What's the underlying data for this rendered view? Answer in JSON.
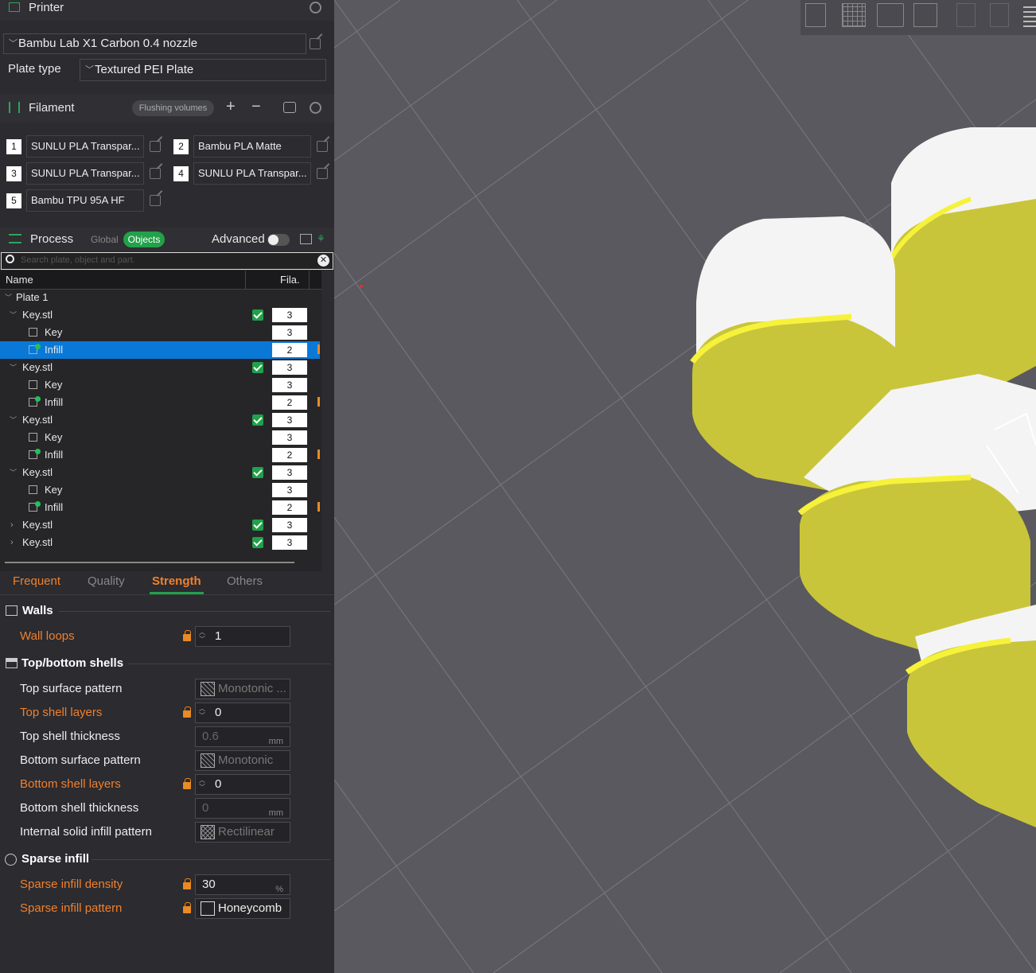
{
  "printer": {
    "title": "Printer",
    "machine": "Bambu Lab X1 Carbon 0.4 nozzle",
    "plate_type_label": "Plate type",
    "plate_type": "Textured PEI Plate"
  },
  "filament": {
    "title": "Filament",
    "flushing_label": "Flushing volumes",
    "slots": [
      {
        "num": "1",
        "name": "SUNLU PLA Transpar..."
      },
      {
        "num": "2",
        "name": "Bambu PLA Matte"
      },
      {
        "num": "3",
        "name": "SUNLU PLA Transpar..."
      },
      {
        "num": "4",
        "name": "SUNLU PLA Transpar..."
      },
      {
        "num": "5",
        "name": "Bambu TPU 95A HF"
      }
    ]
  },
  "process": {
    "title": "Process",
    "global_label": "Global",
    "objects_label": "Objects",
    "advanced_label": "Advanced",
    "search_placeholder": "Search plate, object and part."
  },
  "tree": {
    "col_name": "Name",
    "col_fila": "Fila.",
    "rows": [
      {
        "label": "Plate 1",
        "fila": ""
      },
      {
        "label": "Key.stl",
        "fila": "3"
      },
      {
        "label": "Key",
        "fila": "3"
      },
      {
        "label": "Infill",
        "fila": "2"
      },
      {
        "label": "Key.stl",
        "fila": "3"
      },
      {
        "label": "Key",
        "fila": "3"
      },
      {
        "label": "Infill",
        "fila": "2"
      },
      {
        "label": "Key.stl",
        "fila": "3"
      },
      {
        "label": "Key",
        "fila": "3"
      },
      {
        "label": "Infill",
        "fila": "2"
      },
      {
        "label": "Key.stl",
        "fila": "3"
      },
      {
        "label": "Key",
        "fila": "3"
      },
      {
        "label": "Infill",
        "fila": "2"
      },
      {
        "label": "Key.stl",
        "fila": "3"
      },
      {
        "label": "Key.stl",
        "fila": "3"
      }
    ]
  },
  "tabs": [
    "Frequent",
    "Quality",
    "Strength",
    "Others"
  ],
  "active_tab": "Strength",
  "walls": {
    "title": "Walls",
    "wall_loops_label": "Wall loops",
    "wall_loops": "1"
  },
  "shells": {
    "title": "Top/bottom shells",
    "top_pattern_label": "Top surface pattern",
    "top_pattern": "Monotonic ...",
    "top_layers_label": "Top shell layers",
    "top_layers": "0",
    "top_thickness_label": "Top shell thickness",
    "top_thickness": "0.6",
    "bottom_pattern_label": "Bottom surface pattern",
    "bottom_pattern": "Monotonic",
    "bottom_layers_label": "Bottom shell layers",
    "bottom_layers": "0",
    "bottom_thickness_label": "Bottom shell thickness",
    "bottom_thickness": "0",
    "internal_pattern_label": "Internal solid infill pattern",
    "internal_pattern": "Rectilinear",
    "unit_mm": "mm"
  },
  "sparse": {
    "title": "Sparse infill",
    "density_label": "Sparse infill density",
    "density": "30",
    "density_unit": "%",
    "pattern_label": "Sparse infill pattern",
    "pattern": "Honeycomb"
  },
  "colors": {
    "accent": "#21a14a",
    "warning": "#f0802c",
    "selection": "#0a78d7",
    "model_yellow": "#c9c53a"
  }
}
